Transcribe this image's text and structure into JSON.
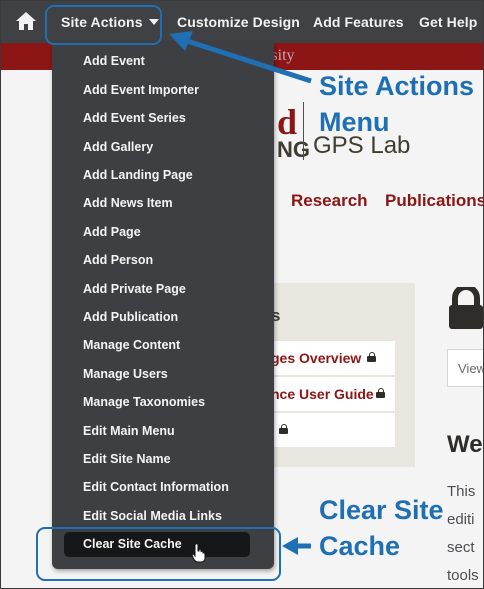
{
  "toolbar": {
    "site_actions": "Site Actions",
    "customize_design": "Customize Design",
    "add_features": "Add Features",
    "get_help": "Get Help"
  },
  "brand": {
    "text": "ersity"
  },
  "page": {
    "logo_fragment": "d",
    "logo_fragment2": "NG",
    "logo_sub": "GPS Lab",
    "nav": [
      "Research",
      "Publications"
    ],
    "side_title": "s",
    "side_links": [
      "ges Overview",
      "nce User Guide",
      ""
    ],
    "view_tab": "View",
    "welcome": "We",
    "body_lines": [
      "This",
      "editi",
      "sect",
      "tools"
    ]
  },
  "menu": {
    "items": [
      "Add Event",
      "Add Event Importer",
      "Add Event Series",
      "Add Gallery",
      "Add Landing Page",
      "Add News Item",
      "Add Page",
      "Add Person",
      "Add Private Page",
      "Add Publication",
      "Manage Content",
      "Manage Users",
      "Manage Taxonomies",
      "Edit Main Menu",
      "Edit Site Name",
      "Edit Contact Information",
      "Edit Social Media Links"
    ],
    "highlighted": "Clear Site Cache"
  },
  "annotations": {
    "site_actions_line1": "Site Actions",
    "site_actions_line2": "Menu",
    "clear_line1": "Clear Site",
    "clear_line2": "Cache",
    "color": "#1f6fb4"
  },
  "colors": {
    "toolbar": "#3f4145",
    "brand": "#8c1515",
    "menu": "#3d3f42",
    "highlight": "#161718"
  }
}
